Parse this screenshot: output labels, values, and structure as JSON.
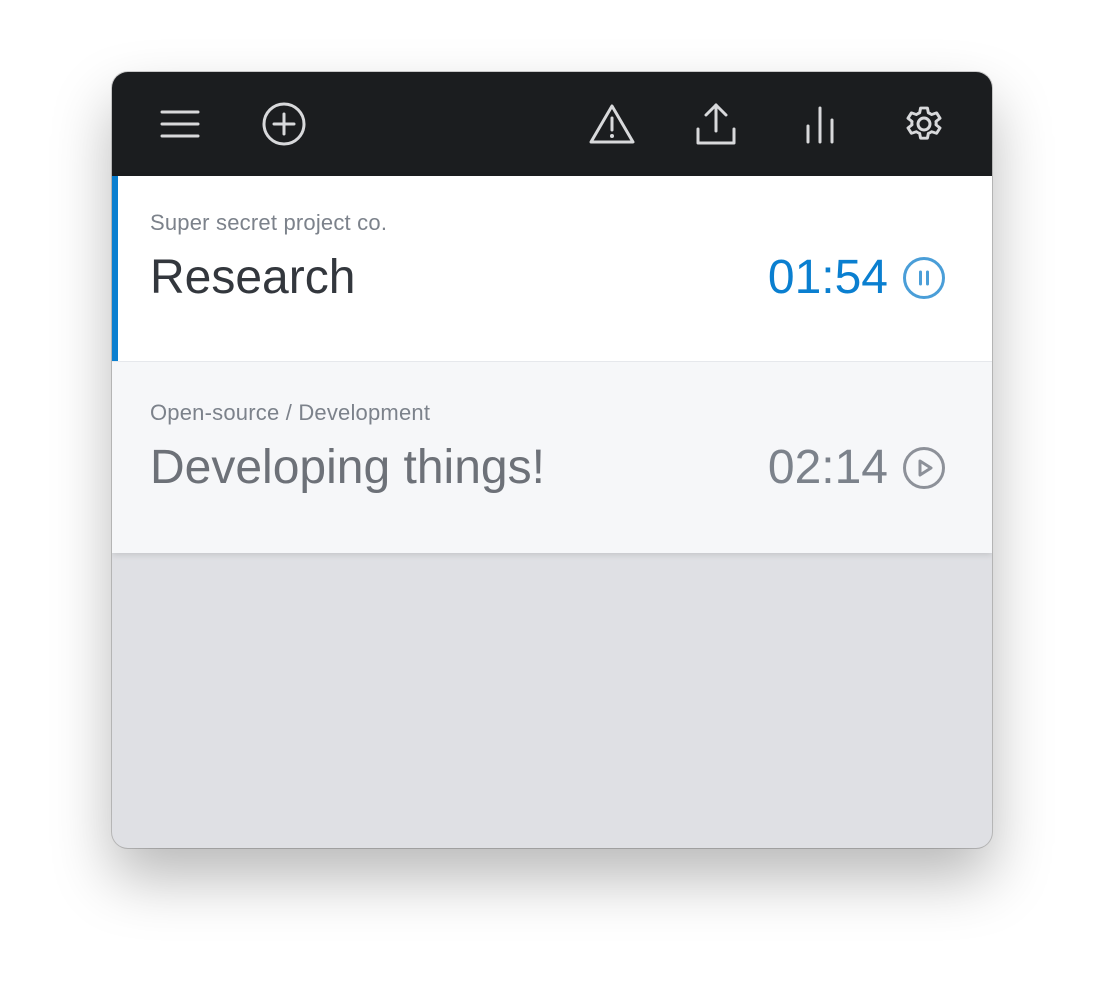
{
  "colors": {
    "toolbar_bg": "#1b1d1f",
    "accent": "#0a7fd0",
    "muted_text": "#7c828b",
    "panel_bg": "#dfe0e4"
  },
  "toolbar": {
    "left_icons": [
      "menu-icon",
      "add-circle-icon"
    ],
    "right_icons": [
      "warning-icon",
      "upload-icon",
      "stats-icon",
      "gear-icon"
    ]
  },
  "entries": [
    {
      "project": "Super secret project co.",
      "task": "Research",
      "time": "01:54",
      "state": "running",
      "control_icon": "pause-icon"
    },
    {
      "project": "Open-source / Development",
      "task": "Developing things!",
      "time": "02:14",
      "state": "stopped",
      "control_icon": "play-icon"
    }
  ]
}
